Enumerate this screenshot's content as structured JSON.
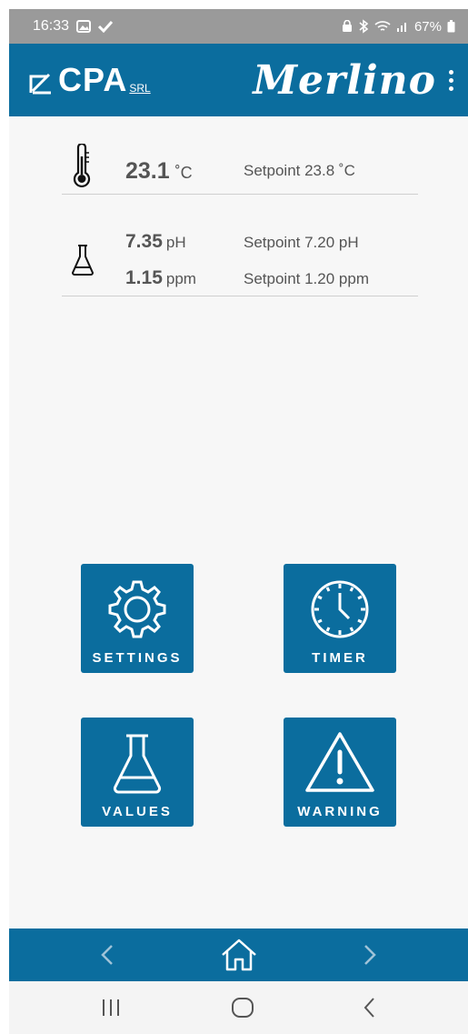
{
  "status_bar": {
    "time": "16:33",
    "battery": "67%"
  },
  "app_bar": {
    "logo_text": "CPA",
    "logo_suffix": "SRL",
    "brand": "Merlino"
  },
  "readings": {
    "temperature": {
      "value": "23.1",
      "unit": "˚C",
      "setpoint": "Setpoint 23.8 ˚C"
    },
    "ph": {
      "value": "7.35",
      "unit": "pH",
      "setpoint": "Setpoint 7.20 pH"
    },
    "chlorine": {
      "value": "1.15",
      "unit": "ppm",
      "setpoint": "Setpoint 1.20 ppm"
    }
  },
  "tiles": {
    "settings": "SETTINGS",
    "timer": "TIMER",
    "values": "VALUES",
    "warning": "WARNING"
  },
  "colors": {
    "primary": "#0b6d9e",
    "status_bar": "#9a9a9a",
    "background": "#f7f7f7"
  },
  "icons": [
    "gallery-icon",
    "check-icon",
    "lock-icon",
    "bluetooth-icon",
    "wifi-icon",
    "signal-icon",
    "battery-icon",
    "thermometer-icon",
    "flask-icon",
    "gear-icon",
    "clock-icon",
    "warning-triangle-icon",
    "home-icon",
    "chevron-left-icon",
    "chevron-right-icon",
    "recents-icon",
    "home-circle-icon",
    "back-icon"
  ]
}
